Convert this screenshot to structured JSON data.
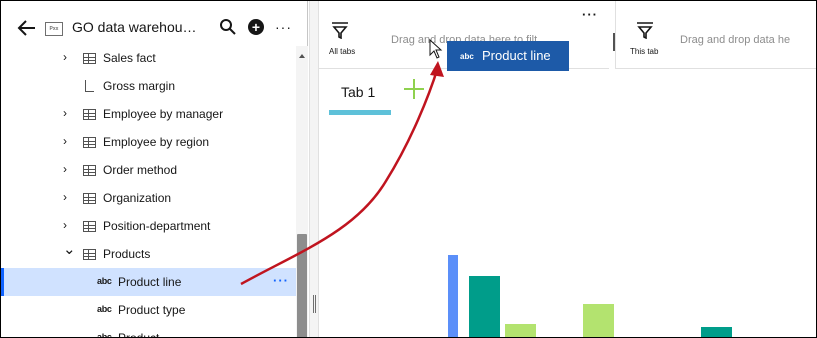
{
  "header": {
    "source_title": "GO data warehou…",
    "source_icon_text": "Pxx",
    "back_icon": "arrow-left-icon",
    "search_icon": "search-icon",
    "add_icon": "plus-circle-icon",
    "more_icon": "overflow-menu-icon"
  },
  "tree": {
    "items": [
      {
        "label": "Sales fact",
        "kind": "table",
        "expandable": true,
        "expanded": false
      },
      {
        "label": "Gross margin",
        "kind": "measure",
        "expandable": false
      },
      {
        "label": "Employee by manager",
        "kind": "table",
        "expandable": true,
        "expanded": false
      },
      {
        "label": "Employee by region",
        "kind": "table",
        "expandable": true,
        "expanded": false
      },
      {
        "label": "Order method",
        "kind": "table",
        "expandable": true,
        "expanded": false
      },
      {
        "label": "Organization",
        "kind": "table",
        "expandable": true,
        "expanded": false
      },
      {
        "label": "Position-department",
        "kind": "table",
        "expandable": true,
        "expanded": false
      },
      {
        "label": "Products",
        "kind": "table",
        "expandable": true,
        "expanded": true
      },
      {
        "label": "Product line",
        "kind": "attribute",
        "selected": true
      },
      {
        "label": "Product type",
        "kind": "attribute"
      },
      {
        "label": "Product",
        "kind": "attribute"
      }
    ],
    "abc_badge": "abc",
    "row_more": "···"
  },
  "filters": {
    "all_tabs": {
      "label": "All tabs",
      "drop_text": "Drag and drop data here to filt…",
      "more": "···"
    },
    "this_tab": {
      "label": "This tab",
      "drop_text": "Drag and drop data he"
    }
  },
  "tabs": [
    {
      "label": "Tab 1",
      "active": true
    }
  ],
  "add_tab_icon": "plus-icon",
  "drag_ghost": {
    "label": "Product line",
    "badge": "abc"
  },
  "colors": {
    "selection": "#d0e2ff",
    "accent": "#0f62fe",
    "tab_underline": "#5ec1d9",
    "drag_ghost": "#1d5aa8",
    "annotation_arrow": "#c0141f",
    "bar_blue": "#5b8ff9",
    "bar_teal": "#009d8a",
    "bar_green": "#b3e36f"
  },
  "chart_data": {
    "type": "bar",
    "note": "partially visible chart at bottom of canvas, values are relative heights",
    "series": [
      {
        "values": [
          0.87
        ],
        "color": "#5b8ff9"
      },
      {
        "values": [
          0.66
        ],
        "color": "#009d8a"
      },
      {
        "values": [
          0.16
        ],
        "color": "#b3e36f"
      },
      {
        "values": [
          0.36
        ],
        "color": "#b3e36f"
      },
      {
        "values": [
          0.12
        ],
        "color": "#009d8a"
      }
    ]
  }
}
